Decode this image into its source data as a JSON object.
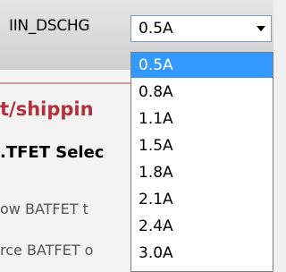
{
  "parameter": {
    "label": "IIN_DSCHG",
    "selected_value": "0.5A"
  },
  "dropdown": {
    "options": [
      "0.5A",
      "0.8A",
      "1.1A",
      "1.5A",
      "1.8A",
      "2.1A",
      "2.4A",
      "3.0A"
    ],
    "highlighted_index": 0
  },
  "background_panel": {
    "section_heading": "t/shippin",
    "sub_heading": ".TFET Selec",
    "option_text_1": "ow BATFET t",
    "option_text_2": "rce BATFET o"
  },
  "colors": {
    "selection": "#3399ff",
    "section_heading": "#b3303a"
  }
}
